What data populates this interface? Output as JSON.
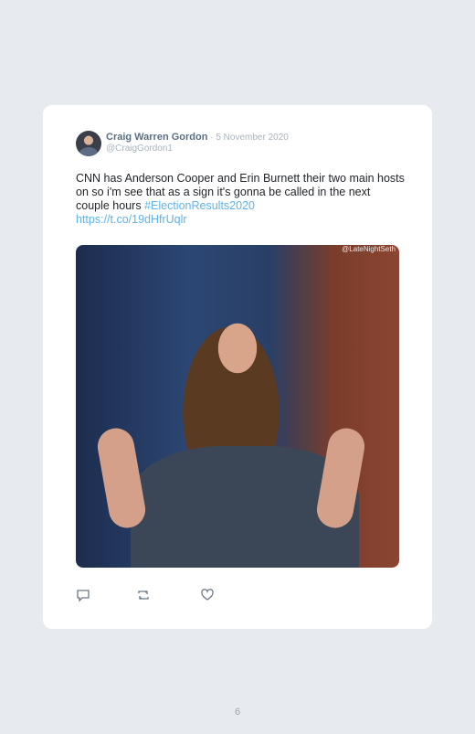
{
  "tweet": {
    "author_name": "Craig Warren Gordon",
    "date": " · 5 November 2020",
    "handle": "@CraigGordon1",
    "text_main": "CNN has Anderson Cooper and Erin Burnett their two main hosts on so i'm see that as a sign it's gonna be called in the next couple hours ",
    "hashtag": "#ElectionResults2020",
    "link": "https://t.co/19dHfrUqlr",
    "media_watermark": "@LateNightSeth"
  },
  "actions": {
    "reply_icon": "reply-icon",
    "retweet_icon": "retweet-icon",
    "like_icon": "heart-icon"
  },
  "page": {
    "number": "6"
  }
}
